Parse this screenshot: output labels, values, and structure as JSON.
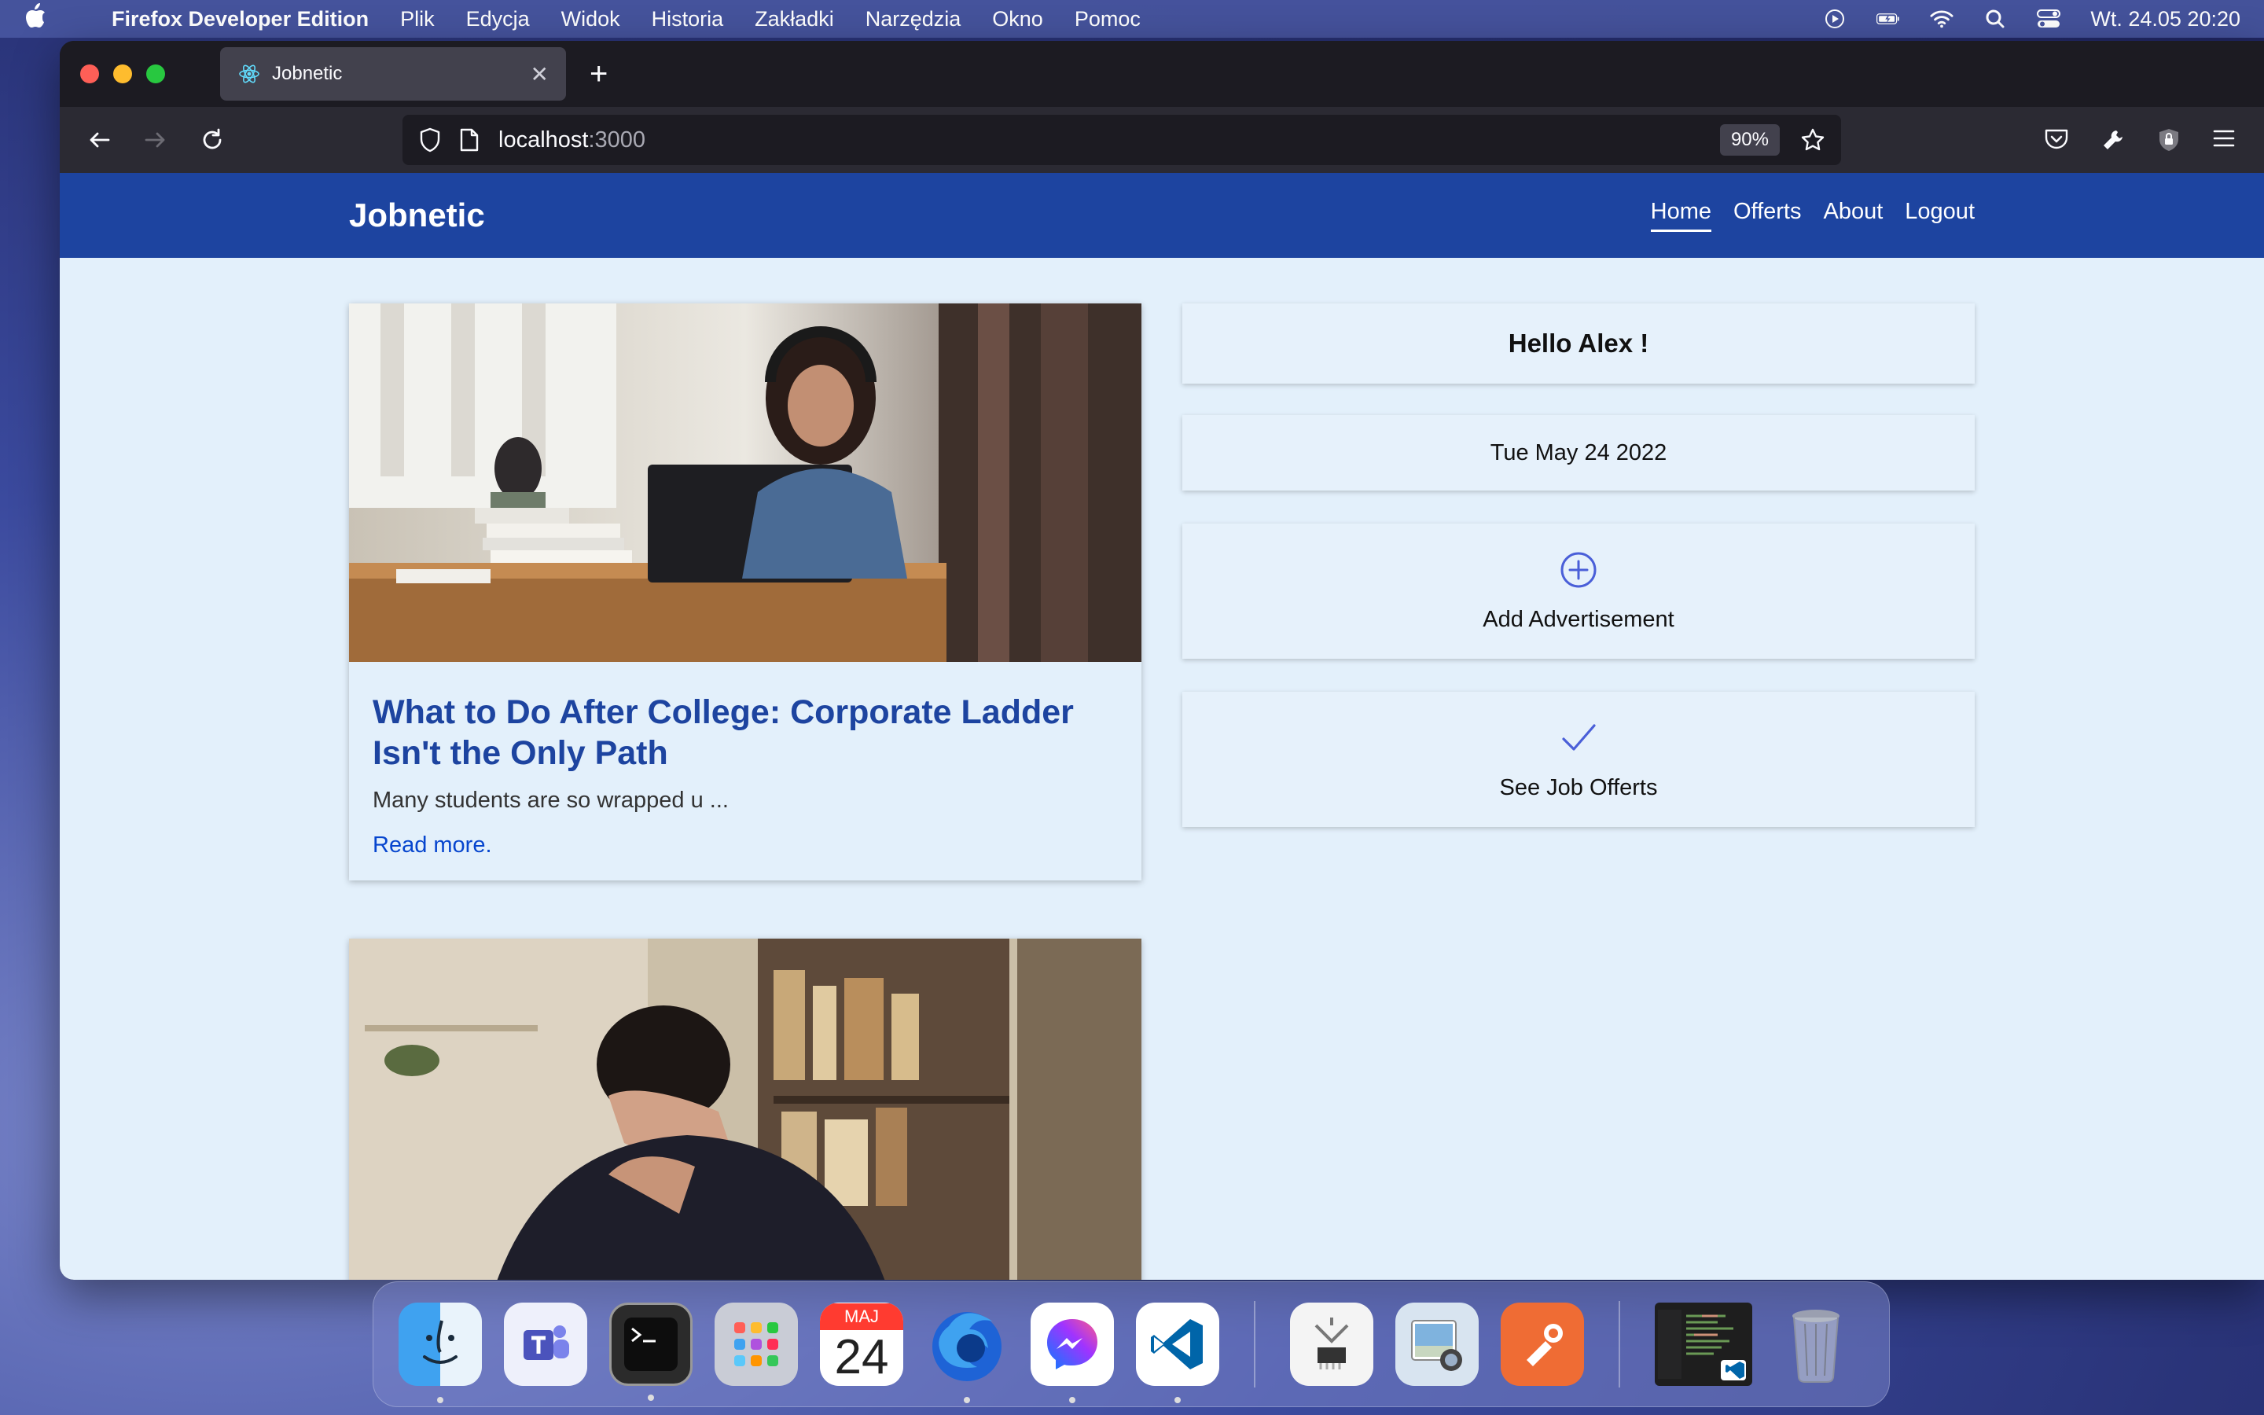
{
  "menubar": {
    "app_name": "Firefox Developer Edition",
    "menus": [
      "Plik",
      "Edycja",
      "Widok",
      "Historia",
      "Zakładki",
      "Narzędzia",
      "Okno",
      "Pomoc"
    ],
    "clock": "Wt. 24.05  20:20"
  },
  "browser": {
    "tab_title": "Jobnetic",
    "url_host": "localhost",
    "url_port": ":3000",
    "zoom": "90%"
  },
  "site": {
    "brand": "Jobnetic",
    "nav": [
      "Home",
      "Offerts",
      "About",
      "Logout"
    ],
    "active_nav": "Home"
  },
  "articles": [
    {
      "title": "What to Do After College: Corporate Ladder Isn't the Only Path",
      "excerpt": "Many students are so wrapped u ...",
      "read_more": "Read more."
    }
  ],
  "sidebar": {
    "greeting": "Hello Alex !",
    "date": "Tue May 24 2022",
    "add_ad_label": "Add Advertisement",
    "see_offers_label": "See Job Offerts"
  },
  "dock": {
    "calendar_month": "MAJ",
    "calendar_day": "24"
  },
  "colors": {
    "header": "#1d44a0",
    "page_bg": "#e3f0fb",
    "title": "#1d44a0",
    "link": "#0645ce",
    "icon_accent": "#4a5fd8"
  }
}
